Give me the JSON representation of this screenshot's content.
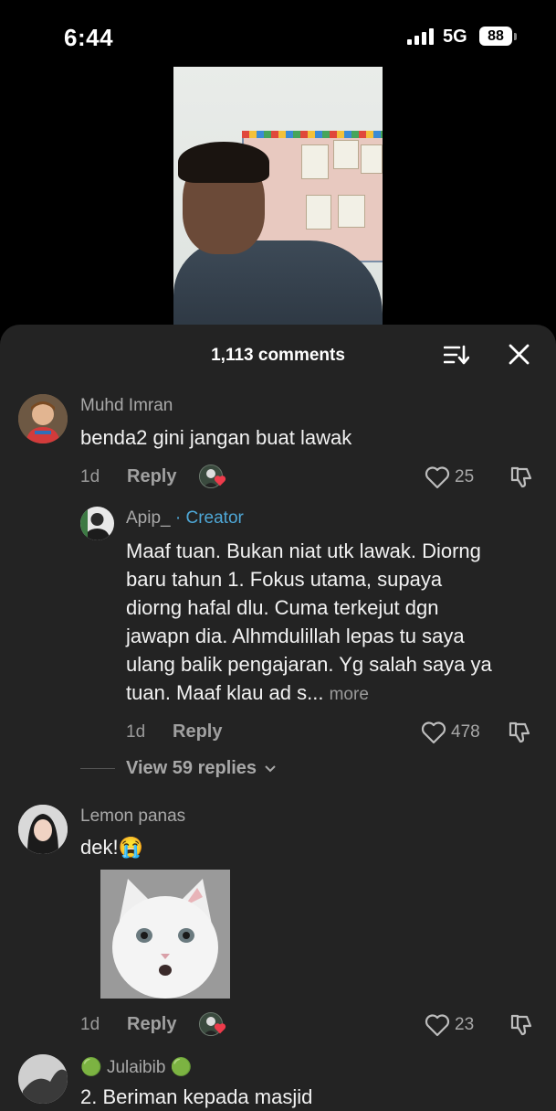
{
  "status_bar": {
    "time": "6:44",
    "network": "5G",
    "battery": "88"
  },
  "comments_header": {
    "count_label": "1,113 comments"
  },
  "comments": [
    {
      "username": "Muhd Imran",
      "text": "benda2 gini jangan buat lawak",
      "age": "1d",
      "reply_label": "Reply",
      "likes": "25",
      "creator_liked": true
    },
    {
      "username": "Apip_",
      "badge_separator": "·",
      "badge": "Creator",
      "text_lines": [
        "Maaf tuan. Bukan niat utk lawak. Diorng",
        "baru tahun 1. Fokus utama, supaya",
        "diorng hafal dlu. Cuma terkejut dgn",
        "jawapn dia. Alhmdulillah lepas tu saya",
        "ulang balik pengajaran. Yg salah saya ya",
        "tuan. Maaf klau ad s..."
      ],
      "more_label": "more",
      "age": "1d",
      "reply_label": "Reply",
      "likes": "478",
      "is_reply": true
    },
    {
      "username": "Lemon panas",
      "text": "dek!",
      "emoji": "😭",
      "has_gif": true,
      "age": "1d",
      "reply_label": "Reply",
      "likes": "23",
      "creator_liked": true
    },
    {
      "username": "Julaibib",
      "name_prefix_emoji": "🟢",
      "name_suffix_emoji": "🟢",
      "text": "2. Beriman kepada masjid"
    }
  ],
  "view_replies_label": "View 59 replies",
  "icons": {
    "sort": "sort-icon",
    "close": "close-icon",
    "heart": "heart-icon",
    "dislike": "dislike-icon",
    "chevron": "chevron-down-icon"
  },
  "colors": {
    "sheet_bg": "#232323",
    "creator_badge": "#4ea7d6",
    "liked_heart": "#ee3b4b"
  }
}
